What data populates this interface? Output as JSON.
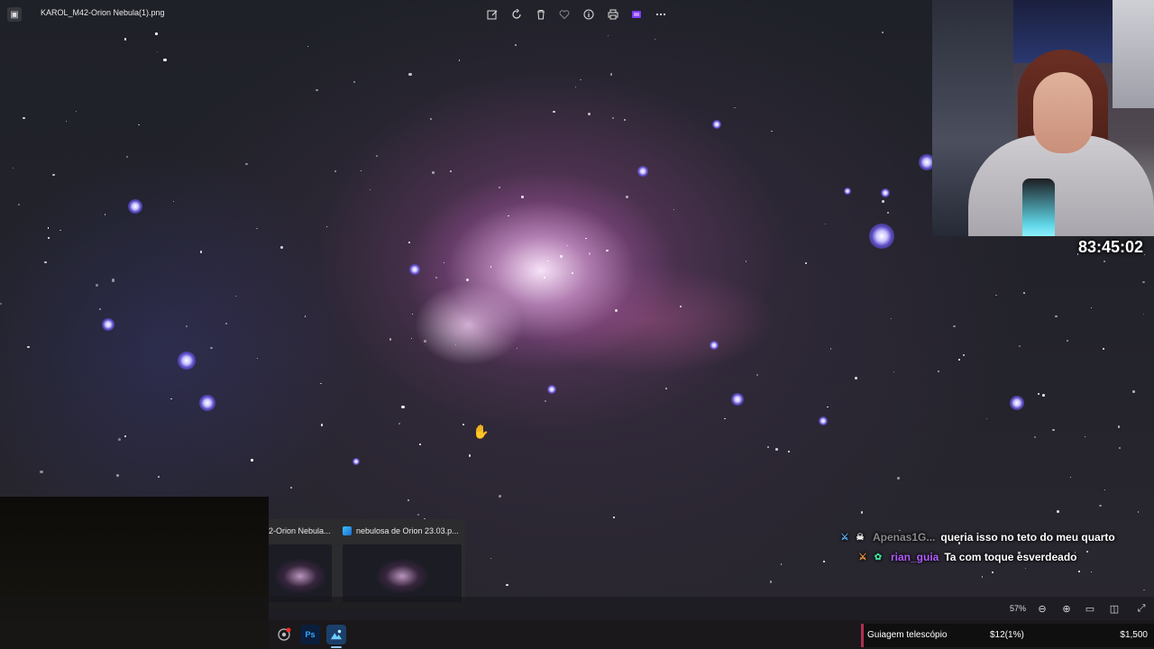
{
  "viewer": {
    "file_title": "KAROL_M42-Orion Nebula(1).png",
    "toolbar_icons": [
      "edit-icon",
      "rotate-icon",
      "delete-icon",
      "favorite-icon",
      "info-icon",
      "print-icon",
      "clipchamp-icon",
      "more-icon"
    ],
    "zoom_level": "57%"
  },
  "stream": {
    "timer": "83:45:02",
    "chat": [
      {
        "user": "Apenas1G...",
        "message": "queria isso no teto do meu quarto",
        "user_color": "#8a8a8a"
      },
      {
        "user": "rian_guia",
        "message": "Ta com toque esverdeado",
        "user_color": "#b25cff"
      }
    ]
  },
  "taskbar_preview": {
    "items": [
      {
        "title": "2-Orion Nebula..."
      },
      {
        "title": "nebulosa de Orion 23.03.p..."
      }
    ]
  },
  "taskbar": {
    "apps": [
      "chrome-icon",
      "Ps",
      "photos-icon"
    ]
  },
  "goal": {
    "label": "Guiagem telescópio",
    "progress": "$12(1%)",
    "target": "$1,500"
  },
  "colors": {
    "accent_goal": "#b03050",
    "viewer_bg": "#14151a"
  }
}
